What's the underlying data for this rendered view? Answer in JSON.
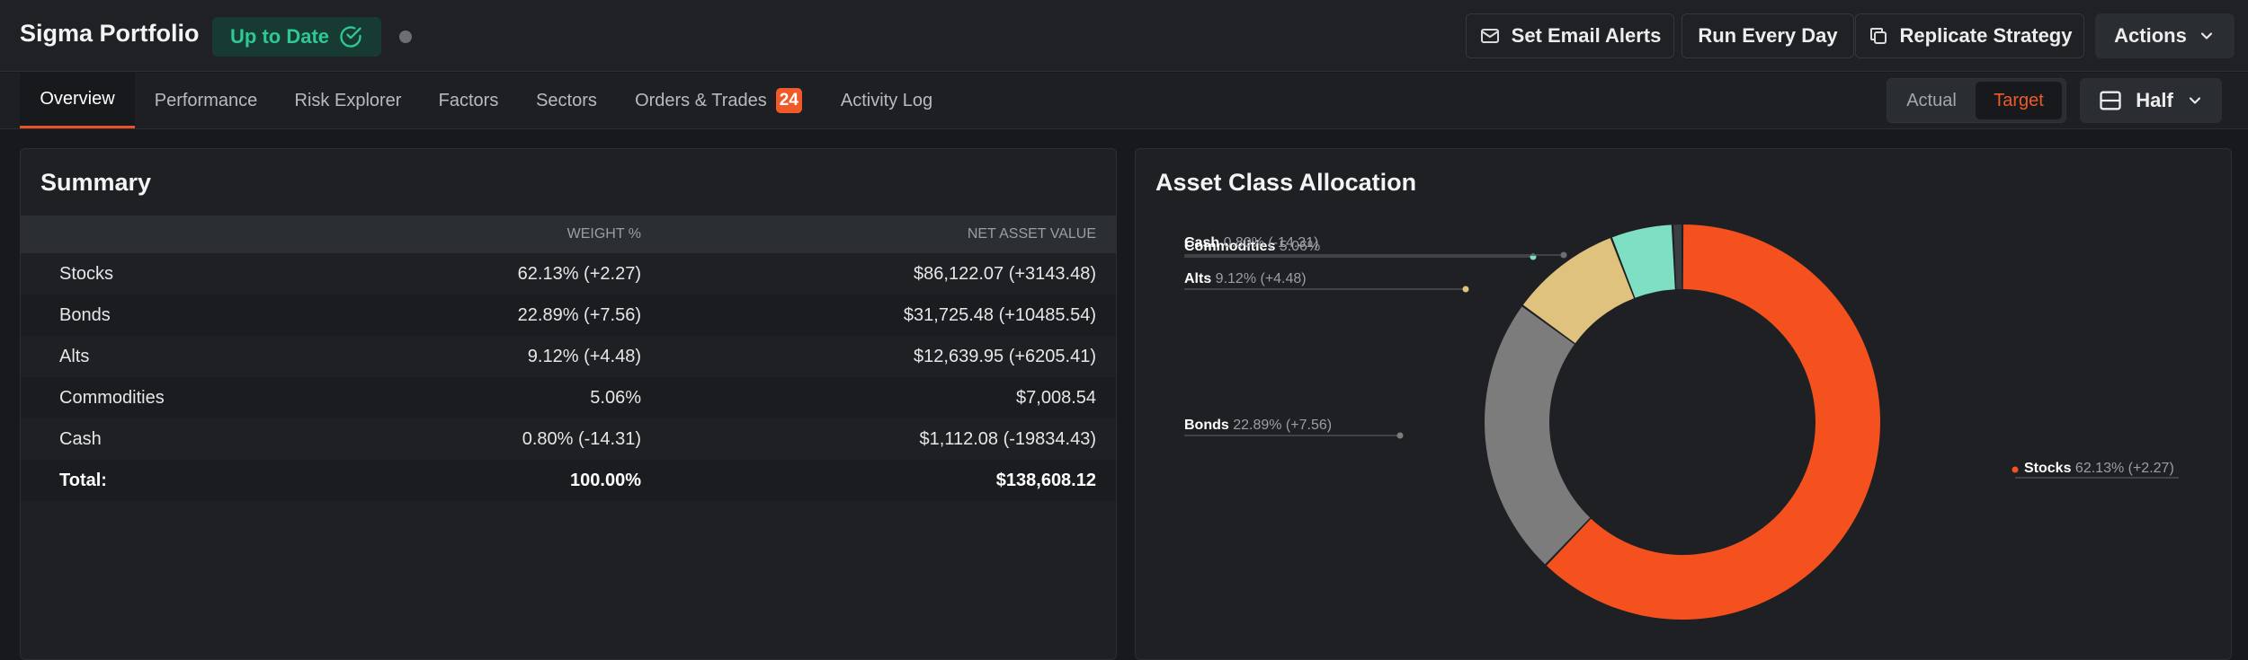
{
  "header": {
    "title": "Sigma Portfolio",
    "status": "Up to Date",
    "buttons": {
      "email": "Set Email Alerts",
      "run": "Run Every Day",
      "replicate": "Replicate Strategy",
      "actions": "Actions"
    }
  },
  "tabs": [
    {
      "label": "Overview",
      "active": true
    },
    {
      "label": "Performance"
    },
    {
      "label": "Risk Explorer"
    },
    {
      "label": "Factors"
    },
    {
      "label": "Sectors"
    },
    {
      "label": "Orders & Trades",
      "badge": "24"
    },
    {
      "label": "Activity Log"
    }
  ],
  "view_toggle": {
    "actual": "Actual",
    "target": "Target",
    "selected": "Target"
  },
  "layout_select": {
    "value": "Half",
    "icon": "layout-split-icon"
  },
  "summary": {
    "title": "Summary",
    "columns": [
      "",
      "WEIGHT %",
      "NET ASSET VALUE"
    ],
    "rows": [
      {
        "name": "Stocks",
        "weight": "62.13% (+2.27)",
        "nav": "$86,122.07 (+3143.48)"
      },
      {
        "name": "Bonds",
        "weight": "22.89% (+7.56)",
        "nav": "$31,725.48 (+10485.54)"
      },
      {
        "name": "Alts",
        "weight": "9.12% (+4.48)",
        "nav": "$12,639.95 (+6205.41)"
      },
      {
        "name": "Commodities",
        "weight": "5.06%",
        "nav": "$7,008.54"
      },
      {
        "name": "Cash",
        "weight": "0.80% (-14.31)",
        "nav": "$1,112.08 (-19834.43)"
      }
    ],
    "total": {
      "name": "Total:",
      "weight": "100.00%",
      "nav": "$138,608.12"
    }
  },
  "allocation": {
    "title": "Asset Class Allocation",
    "chart_data": {
      "type": "pie",
      "donut": true,
      "slices": [
        {
          "name": "Stocks",
          "value": 62.13,
          "change": "62.13% (+2.27)",
          "color": "#f4511e"
        },
        {
          "name": "Bonds",
          "value": 22.89,
          "change": "22.89% (+7.56)",
          "color": "#7c7c7c"
        },
        {
          "name": "Alts",
          "value": 9.12,
          "change": "9.12% (+4.48)",
          "color": "#dfc27d"
        },
        {
          "name": "Commodities",
          "value": 5.06,
          "change": "5.06%",
          "color": "#7fdfc3"
        },
        {
          "name": "Cash",
          "value": 0.8,
          "change": "0.80% (-14.31)",
          "color": "#3a3d41"
        }
      ]
    }
  },
  "colors": {
    "accent": "#f05a28",
    "status_green": "#2fc795",
    "background": "#17191c"
  }
}
